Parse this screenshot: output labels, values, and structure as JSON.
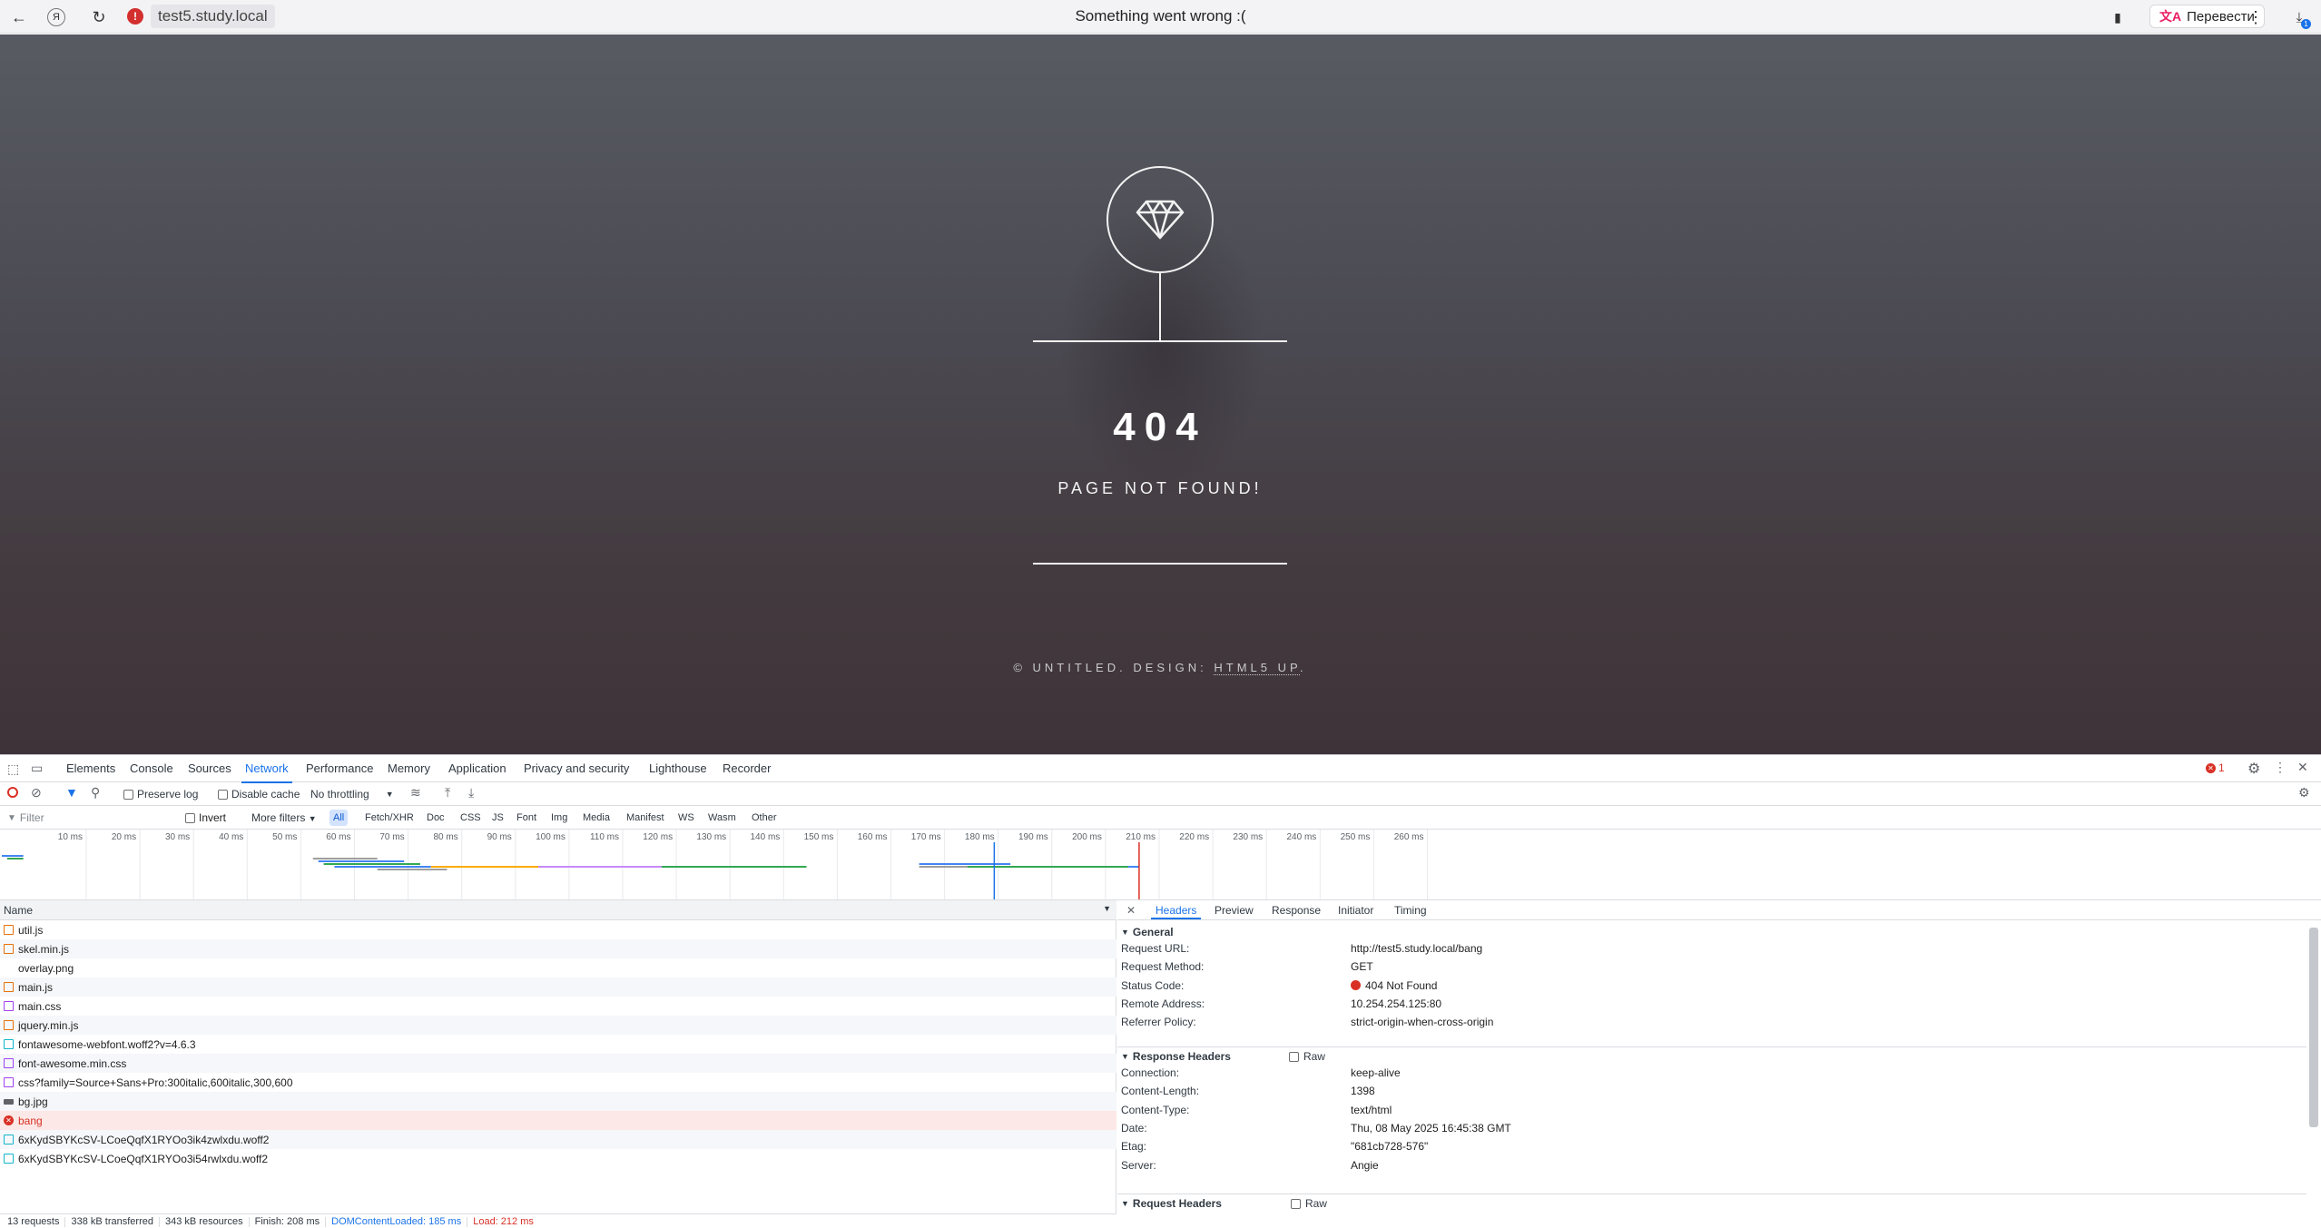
{
  "browser": {
    "url": "test5.study.local",
    "tab_title": "Something went wrong :(",
    "translate_label": "Перевести",
    "download_badge": "1"
  },
  "page": {
    "error_code": "404",
    "error_message": "PAGE NOT FOUND!",
    "footer_prefix": "© UNTITLED. DESIGN: ",
    "footer_link": "HTML5 UP",
    "footer_suffix": "."
  },
  "devtools": {
    "tabs": [
      "Elements",
      "Console",
      "Sources",
      "Network",
      "Performance",
      "Memory",
      "Application",
      "Privacy and security",
      "Lighthouse",
      "Recorder"
    ],
    "active_tab": "Network",
    "error_count": "1",
    "toolbar": {
      "preserve_log": "Preserve log",
      "disable_cache": "Disable cache",
      "throttling": "No throttling"
    },
    "filters": {
      "placeholder": "Filter",
      "invert": "Invert",
      "more_filters": "More filters",
      "chips": [
        "All",
        "Fetch/XHR",
        "Doc",
        "CSS",
        "JS",
        "Font",
        "Img",
        "Media",
        "Manifest",
        "WS",
        "Wasm",
        "Other"
      ]
    },
    "timeline_ticks": [
      "10 ms",
      "20 ms",
      "30 ms",
      "40 ms",
      "50 ms",
      "60 ms",
      "70 ms",
      "80 ms",
      "90 ms",
      "100 ms",
      "110 ms",
      "120 ms",
      "130 ms",
      "140 ms",
      "150 ms",
      "160 ms",
      "170 ms",
      "180 ms",
      "190 ms",
      "200 ms",
      "210 ms",
      "220 ms",
      "230 ms",
      "240 ms",
      "250 ms",
      "260 ms"
    ],
    "requests_header": "Name",
    "requests": [
      {
        "name": "util.js",
        "type": "js"
      },
      {
        "name": "skel.min.js",
        "type": "js"
      },
      {
        "name": "overlay.png",
        "type": "none"
      },
      {
        "name": "main.js",
        "type": "js"
      },
      {
        "name": "main.css",
        "type": "css"
      },
      {
        "name": "jquery.min.js",
        "type": "js"
      },
      {
        "name": "fontawesome-webfont.woff2?v=4.6.3",
        "type": "font"
      },
      {
        "name": "font-awesome.min.css",
        "type": "css"
      },
      {
        "name": "css?family=Source+Sans+Pro:300italic,600italic,300,600",
        "type": "css"
      },
      {
        "name": "bg.jpg",
        "type": "img"
      },
      {
        "name": "bang",
        "type": "error"
      },
      {
        "name": "6xKydSBYKcSV-LCoeQqfX1RYOo3ik4zwlxdu.woff2",
        "type": "font"
      },
      {
        "name": "6xKydSBYKcSV-LCoeQqfX1RYOo3i54rwlxdu.woff2",
        "type": "font"
      }
    ],
    "status": {
      "requests": "13 requests",
      "transferred": "338 kB transferred",
      "resources": "343 kB resources",
      "finish": "Finish: 208 ms",
      "dom_loaded": "DOMContentLoaded: 185 ms",
      "load": "Load: 212 ms"
    },
    "details": {
      "tabs": [
        "Headers",
        "Preview",
        "Response",
        "Initiator",
        "Timing"
      ],
      "active_tab": "Headers",
      "general_title": "General",
      "general": [
        {
          "k": "Request URL:",
          "v": "http://test5.study.local/bang"
        },
        {
          "k": "Request Method:",
          "v": "GET"
        },
        {
          "k": "Status Code:",
          "v": "404 Not Found"
        },
        {
          "k": "Remote Address:",
          "v": "10.254.254.125:80"
        },
        {
          "k": "Referrer Policy:",
          "v": "strict-origin-when-cross-origin"
        }
      ],
      "response_title": "Response Headers",
      "raw_label": "Raw",
      "response": [
        {
          "k": "Connection:",
          "v": "keep-alive"
        },
        {
          "k": "Content-Length:",
          "v": "1398"
        },
        {
          "k": "Content-Type:",
          "v": "text/html"
        },
        {
          "k": "Date:",
          "v": "Thu, 08 May 2025 16:45:38 GMT"
        },
        {
          "k": "Etag:",
          "v": "\"681cb728-576\""
        },
        {
          "k": "Server:",
          "v": "Angie"
        }
      ],
      "request_title": "Request Headers"
    }
  },
  "colors": {
    "accent": "#1a73e8",
    "error": "#d93025"
  }
}
